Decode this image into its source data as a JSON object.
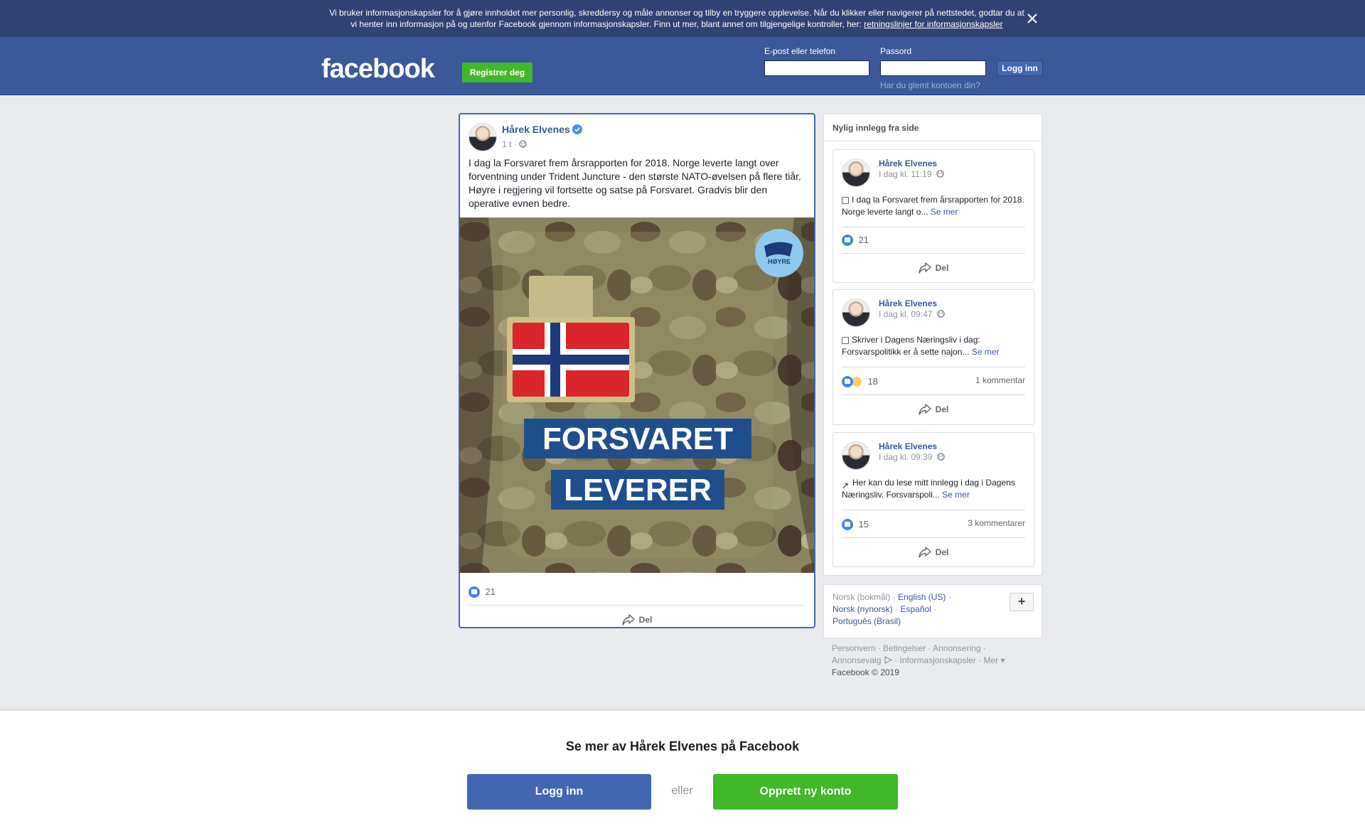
{
  "cookie_banner": {
    "text_line1": "Vi bruker informasjonskapsler for å gjøre innholdet mer personlig, skreddersy og måle annonser og tilby en tryggere opplevelse. Når du klikker eller navigerer på nettstedet, godtar du at",
    "text_line2": "vi henter inn informasjon på og utenfor Facebook gjennom informasjonskapsler. Finn ut mer, blant annet om tilgjengelige kontroller, her:",
    "link": "retningslinjer for informasjonskapsler"
  },
  "header": {
    "logo": "facebook",
    "register_label": "Registrer deg",
    "email_label": "E-post eller telefon",
    "email_value": "",
    "password_label": "Passord",
    "password_value": "",
    "login_label": "Logg inn",
    "forgot_label": "Har du glemt kontoen din?"
  },
  "post": {
    "author": "Hårek Elvenes",
    "time": "1 t",
    "text": "I dag la Forsvaret frem årsrapporten for 2018. Norge leverte langt over forventning under Trident Juncture - den største NATO-øvelsen på flere tiår. Høyre i regjering vil fortsette og satse på Forsvaret. Gradvis blir den operative evnen bedre.",
    "image_text_line1": "FORSVARET",
    "image_text_line2": "LEVERER",
    "badge_text": "HØYRE",
    "likes": "21",
    "share_label": "Del"
  },
  "sidebar": {
    "heading": "Nylig innlegg fra side",
    "posts": [
      {
        "author": "Hårek Elvenes",
        "time": "I dag kl. 11:19",
        "text": "I dag la Forsvaret frem årsrapporten for 2018. Norge leverte langt o...",
        "more": "Se mer",
        "likes": "21",
        "comments": "",
        "share": "Del"
      },
      {
        "author": "Hårek Elvenes",
        "time": "I dag kl. 09:47",
        "text": "Skriver i Dagens Næringsliv i dag: Forsvarspolitikk er å sette najon...",
        "more": "Se mer",
        "likes": "18",
        "comments": "1 kommentar",
        "share": "Del"
      },
      {
        "author": "Hårek Elvenes",
        "time": "I dag kl. 09:39",
        "text": "Her kan du lese mitt innlegg i dag i Dagens Næringsliv. Forsvarspoli...",
        "more": "Se mer",
        "likes": "15",
        "comments": "3 kommentarer",
        "share": "Del"
      }
    ]
  },
  "languages": {
    "current": "Norsk (bokmål)",
    "items": [
      "English (US)",
      "Norsk (nynorsk)",
      "Español",
      "Português (Brasil)"
    ],
    "plus": "+"
  },
  "footer": {
    "links": [
      "Personvern",
      "Betingelser",
      "Annonsering",
      "Annonsevalg",
      "Informasjonskapsler",
      "Mer"
    ],
    "copyright": "Facebook © 2019"
  },
  "bottom_bar": {
    "title": "Se mer av Hårek Elvenes på Facebook",
    "login": "Logg inn",
    "or": "eller",
    "signup": "Opprett ny konto"
  },
  "colors": {
    "brand_blue": "#3b5998",
    "button_blue": "#4267b2",
    "green": "#42b72a",
    "link": "#385898"
  }
}
